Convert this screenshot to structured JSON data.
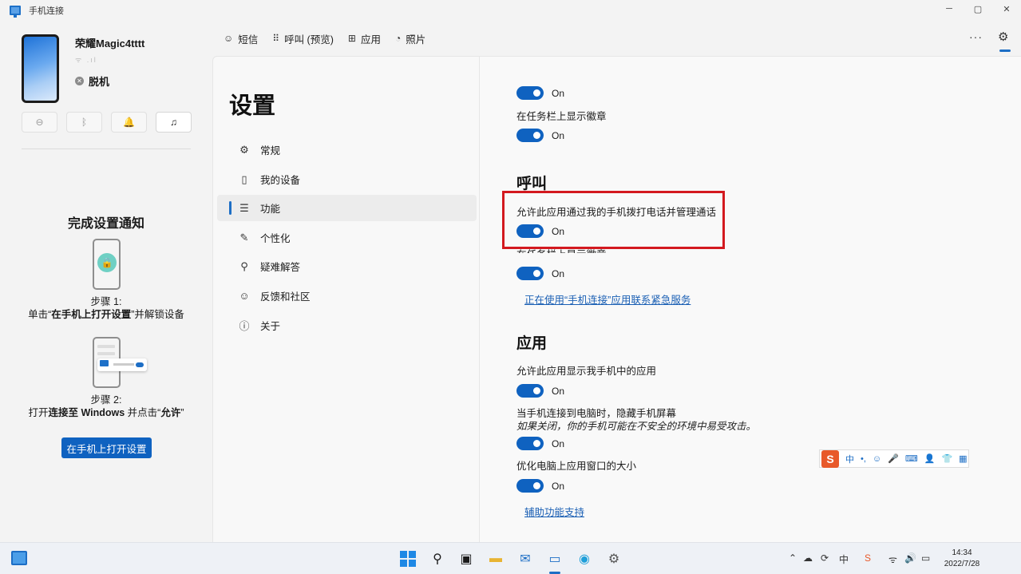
{
  "window": {
    "title": "手机连接",
    "controls": [
      "─",
      "▢",
      "✕"
    ]
  },
  "device": {
    "name": "荣耀Magic4tttt",
    "signal": "ᯤ .ıl",
    "status": "脱机",
    "quick_actions": [
      {
        "icon": "do-not-disturb-icon",
        "glyph": "⊖"
      },
      {
        "icon": "bluetooth-icon",
        "glyph": "ᛒ"
      },
      {
        "icon": "bell-icon",
        "glyph": "🔔"
      },
      {
        "icon": "music-note-icon",
        "glyph": "♫"
      }
    ]
  },
  "setup": {
    "title": "完成设置通知",
    "step1_label": "步骤 1:",
    "step1_text_pre": "单击“",
    "step1_text_bold": "在手机上打开设置",
    "step1_text_post": "”并解锁设备",
    "step2_label": "步骤 2:",
    "step2_text_pre": "打开",
    "step2_text_bold1": "连接至 Windows",
    "step2_text_mid": " 并点击“",
    "step2_text_bold2": "允许",
    "step2_text_post": "”",
    "button": "在手机上打开设置"
  },
  "tabs": [
    {
      "label": "短信",
      "icon": "message-icon",
      "glyph": "☺"
    },
    {
      "label": "呼叫 (预览)",
      "icon": "dialpad-icon",
      "glyph": "⠿"
    },
    {
      "label": "应用",
      "icon": "apps-icon",
      "glyph": "⊞"
    },
    {
      "label": "照片",
      "icon": "photos-icon",
      "glyph": "◔"
    }
  ],
  "toolbar": {
    "more": "···",
    "settings": "⚙"
  },
  "settings": {
    "title": "设置",
    "nav": [
      {
        "label": "常规",
        "icon": "gear-icon",
        "glyph": "⚙"
      },
      {
        "label": "我的设备",
        "icon": "phone-icon",
        "glyph": "▯"
      },
      {
        "label": "功能",
        "icon": "list-icon",
        "glyph": "☰"
      },
      {
        "label": "个性化",
        "icon": "pen-icon",
        "glyph": "✎"
      },
      {
        "label": "疑难解答",
        "icon": "troubleshoot-icon",
        "glyph": "⚲"
      },
      {
        "label": "反馈和社区",
        "icon": "feedback-icon",
        "glyph": "☺"
      },
      {
        "label": "关于",
        "icon": "info-icon",
        "glyph": "ⓘ"
      }
    ],
    "active_index": 2
  },
  "content": {
    "toggle_on": "On",
    "show_badge": "在任务栏上显示徽章",
    "calls_heading": "呼叫",
    "calls_allow": "允许此应用通过我的手机拨打电话并管理通话",
    "calls_badge_partial": "在任务栏上显示徽章",
    "emergency_link": "正在使用“手机连接”应用联系紧急服务",
    "apps_heading": "应用",
    "apps_allow": "允许此应用显示我手机中的应用",
    "hide_screen": "当手机连接到电脑时，隐藏手机屏幕",
    "hide_screen_note": "如果关闭，你的手机可能在不安全的环境中易受攻击。",
    "optimize_size": "优化电脑上应用窗口的大小",
    "accessibility_link": "辅助功能支持"
  },
  "ime": {
    "logo": "S",
    "items": [
      "中",
      "•,",
      "☺",
      "🎤",
      "⌨",
      "👤",
      "👕",
      "▦"
    ]
  },
  "taskbar": {
    "ime_indicator": "中",
    "time": "14:34",
    "date": "2022/7/28"
  },
  "colors": {
    "accent": "#0f62c0",
    "highlight": "#d3191f"
  }
}
